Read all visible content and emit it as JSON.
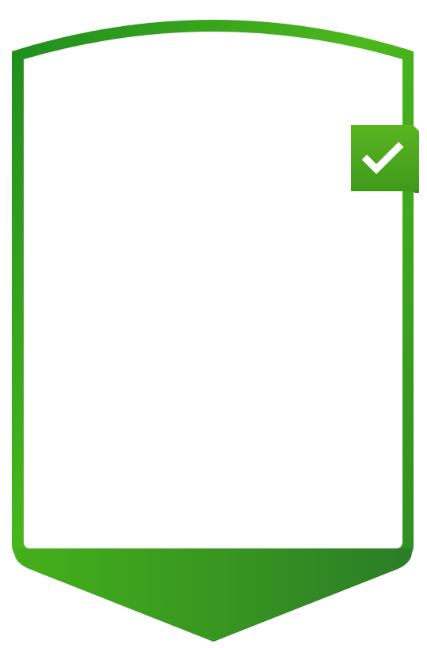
{
  "card": {
    "border_color_light": "#4cb81d",
    "border_color_dark": "#1e8c1e",
    "banner_color_left": "#45b01a",
    "banner_color_right": "#2b7d27",
    "background": "#ffffff"
  },
  "badge": {
    "state": "checked",
    "icon": "checkmark-icon",
    "color_top": "#5ab520",
    "color_bottom": "#3f9a1c",
    "fold_color": "#2f7a1e",
    "icon_color": "#ffffff"
  }
}
